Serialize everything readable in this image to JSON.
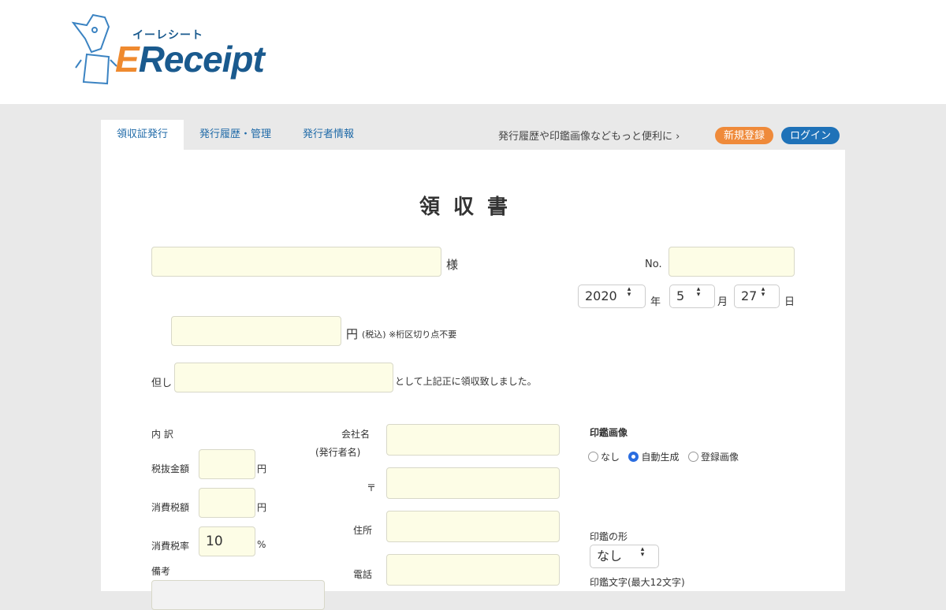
{
  "logo": {
    "kana": "イーレシート",
    "e": "E",
    "rest": "Receipt"
  },
  "tabs": [
    {
      "label": "領収証発行"
    },
    {
      "label": "発行履歴・管理"
    },
    {
      "label": "発行者情報"
    }
  ],
  "promo": "発行履歴や印鑑画像などもっと便利に ›",
  "register_label": "新規登録",
  "login_label": "ログイン",
  "form": {
    "title": "領 収 書",
    "recipient_value": "",
    "recipient_suffix": "様",
    "no_label": "No.",
    "no_value": "",
    "year": "2020",
    "year_label": "年",
    "month": "5",
    "month_label": "月",
    "day": "27",
    "day_label": "日",
    "amount_value": "",
    "amount_suffix": "円",
    "amount_note": "(税込) ※桁区切り点不要",
    "tadashi_label": "但し",
    "tadashi_value": "",
    "tadashi_suffix": "として上記正に領収致しました。",
    "breakdown_label": "内 訳",
    "pretax_label": "税抜金額",
    "pretax_value": "",
    "pretax_unit": "円",
    "tax_label": "消費税額",
    "tax_value": "",
    "tax_unit": "円",
    "rate_label": "消費税率",
    "rate_value": "10",
    "rate_unit": "%",
    "remarks_label": "備考",
    "company_label": "会社名",
    "company_sub": "(発行者名)",
    "company_value": "",
    "zip_label": "〒",
    "zip_value": "",
    "address_label": "住所",
    "address_value": "",
    "phone_label": "電話",
    "phone_value": "",
    "seal_image_label": "印鑑画像",
    "seal_options": [
      "なし",
      "自動生成",
      "登録画像"
    ],
    "seal_selected": "自動生成",
    "seal_shape_label": "印鑑の形",
    "seal_shape_value": "なし",
    "seal_text_label": "印鑑文字(最大12文字)"
  }
}
